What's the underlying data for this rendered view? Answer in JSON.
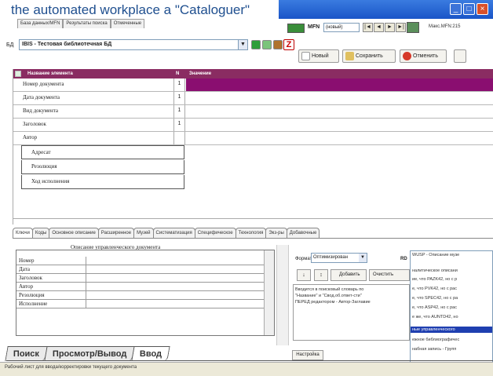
{
  "hero_title": "the automated workplace a \"Cataloguer\"",
  "top_tabs": [
    "База данных/MFN",
    "Результаты поиска",
    "Отмеченные"
  ],
  "db": {
    "label": "БД",
    "value": "IBIS - Тестовая библиотечная БД"
  },
  "toolbar": {
    "mfn_label": "MFN",
    "mfn_value": "(новый)",
    "max_mfn": "Макс.MFN:215",
    "nav": [
      "|◄",
      "◄",
      "►",
      "►|"
    ],
    "btn_new": "Новый",
    "btn_save": "Сохранить",
    "btn_cancel": "Отменить",
    "z_icon": "Z"
  },
  "grid": {
    "headers": {
      "name": "Название элемента",
      "num": "N",
      "value": "Значение"
    },
    "rows": [
      {
        "name": "Номер документа",
        "num": "1"
      },
      {
        "name": "Дата документа",
        "num": "1"
      },
      {
        "name": "Вид документа",
        "num": "1"
      },
      {
        "name": "Заголовок",
        "num": "1"
      },
      {
        "name": "Автор",
        "num": ""
      }
    ],
    "subrows": [
      "Адресат",
      "Резолюция",
      "Ход исполнения"
    ]
  },
  "lower_tabs": [
    "Ключи",
    "Коды",
    "Основное описание",
    "Расширенное",
    "Музей",
    "Систематизация",
    "Специфическое",
    "Технология",
    "Экз-ры",
    "Добавочные"
  ],
  "lower_table": {
    "title": "Описание управленческого документа",
    "rows": [
      "Номер",
      "Дата",
      "Заголовок",
      "Автор",
      "Резолюция",
      "Исполнение"
    ]
  },
  "right_panel": {
    "format_label": "Формат",
    "format_value": "Оптимизирован",
    "rd_label": "RD",
    "btn_add": "Добавить",
    "btn_clear": "Очистить",
    "small_btn1": "↓",
    "small_btn2": "↕",
    "info_lines": [
      "Вводится в поисковый словарь по",
      "\"Название\" и \"Свод.об.ответ-сти\"",
      "ПЕРЕД редактором - Автор-Заглавие"
    ],
    "rd_lines": [
      "WUSP - Описание музе",
      "налитическое описани",
      "ие, что PAZK42, но с р",
      "е, что PVK42, но с рас",
      "е, что SPEC42, но с ра",
      "е, что ASP42, но с рас",
      "е же, что AUNTD42, но",
      "ные  управленческого",
      "ежное библиографичес",
      "набная запись - Групп"
    ]
  },
  "settings_label": "Настройка",
  "bottom_tabs": [
    "Поиск",
    "Просмотр/Вывод",
    "Ввод"
  ],
  "status_text": "Рабочий лист для ввода/корректировки текущего документа"
}
